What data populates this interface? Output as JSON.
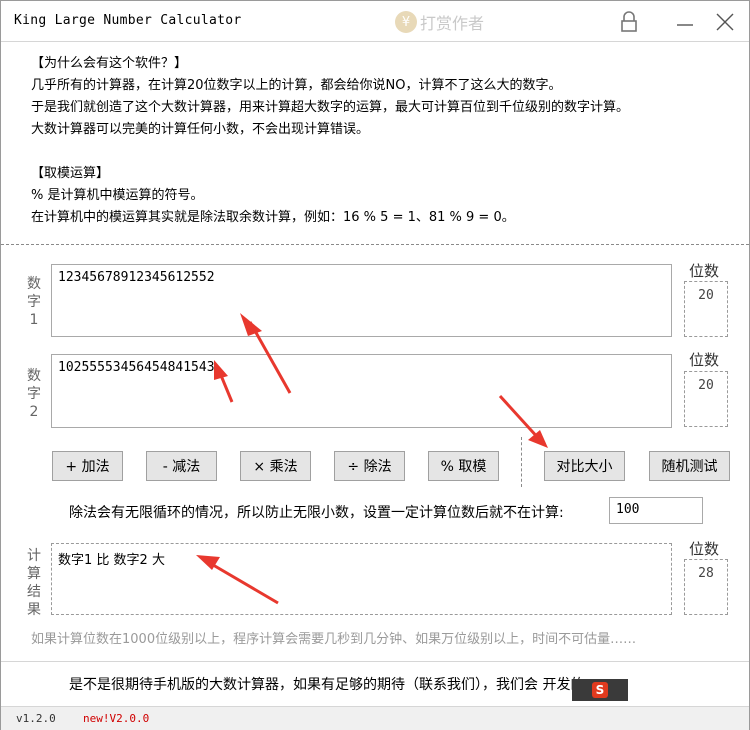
{
  "window": {
    "title": "King Large Number Calculator",
    "reward_label": "打赏作者",
    "reward_coin": "¥"
  },
  "intro": {
    "lines": [
      "【为什么会有这个软件？】",
      "几乎所有的计算器，在计算20位数字以上的计算，都会给你说NO，计算不了这么大的数字。",
      "于是我们就创造了这个大数计算器，用来计算超大数字的运算，最大可计算百位到千位级别的数字计算。",
      "大数计算器可以完美的计算任何小数，不会出现计算错误。",
      "",
      "【取模运算】",
      "% 是计算机中模运算的符号。",
      "在计算机中的模运算其实就是除法取余数计算，例如：16 % 5 = 1、81 % 9 = 0。"
    ]
  },
  "number1": {
    "label": "数字1",
    "value": "12345678912345612552",
    "digits_label": "位数",
    "digits": "20"
  },
  "number2": {
    "label": "数字2",
    "value": "10255553456454841543",
    "digits_label": "位数",
    "digits": "20"
  },
  "buttons": {
    "add": "+ 加法",
    "subtract": "- 减法",
    "multiply": "× 乘法",
    "divide": "÷ 除法",
    "modulo": "% 取模",
    "compare": "对比大小",
    "random": "随机测试"
  },
  "precision": {
    "note": "除法会有无限循环的情况，所以防止无限小数，设置一定计算位数后就不在计算:",
    "value": "100"
  },
  "result": {
    "label": "计算结果",
    "value": "数字1 比 数字2 大",
    "digits_label": "位数",
    "digits": "28"
  },
  "warning": "如果计算位数在1000位级别以上，程序计算会需要几秒到几分钟、如果万位级别以上，时间不可估量……",
  "promo": "是不是很期待手机版的大数计算器，如果有足够的期待（联系我们），我们会 ",
  "promo_tail": "开发的……",
  "footer": {
    "version": "v1.2.0",
    "new_version": "new!V2.0.0"
  },
  "ime": {
    "icon_letter": "S"
  },
  "icons": [
    "coin-icon",
    "lock-icon",
    "minimize-icon",
    "close-icon",
    "annotation-arrow-icon",
    "ime-icon"
  ],
  "colors": {
    "accent_red": "#e8382e",
    "version_red": "#d00000"
  }
}
